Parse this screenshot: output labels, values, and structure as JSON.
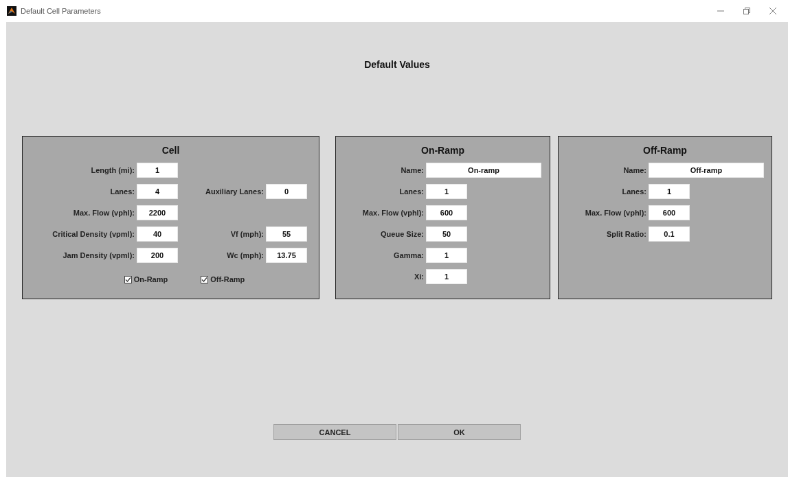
{
  "window": {
    "title": "Default Cell Parameters"
  },
  "heading": "Default Values",
  "cell": {
    "title": "Cell",
    "rows": [
      {
        "left": {
          "label": "Length (mi):",
          "value": "1"
        }
      },
      {
        "left": {
          "label": "Lanes:",
          "value": "4"
        },
        "right": {
          "label": "Auxiliary Lanes:",
          "value": "0"
        }
      },
      {
        "left": {
          "label": "Max. Flow (vphl):",
          "value": "2200"
        }
      },
      {
        "left": {
          "label": "Critical Density (vpml):",
          "value": "40"
        },
        "right": {
          "label": "Vf (mph):",
          "value": "55"
        }
      },
      {
        "left": {
          "label": "Jam Density (vpml):",
          "value": "200"
        },
        "right": {
          "label": "Wc (mph):",
          "value": "13.75"
        }
      }
    ],
    "checkboxes": [
      {
        "label": "On-Ramp",
        "checked": true
      },
      {
        "label": "Off-Ramp",
        "checked": true
      }
    ]
  },
  "on_ramp": {
    "title": "On-Ramp",
    "fields": [
      {
        "label": "Name:",
        "value": "On-ramp",
        "kind": "wide"
      },
      {
        "label": "Lanes:",
        "value": "1",
        "kind": "short"
      },
      {
        "label": "Max. Flow (vphl):",
        "value": "600",
        "kind": "short"
      },
      {
        "label": "Queue Size:",
        "value": "50",
        "kind": "short"
      },
      {
        "label": "Gamma:",
        "value": "1",
        "kind": "short"
      },
      {
        "label": "Xi:",
        "value": "1",
        "kind": "short"
      }
    ]
  },
  "off_ramp": {
    "title": "Off-Ramp",
    "fields": [
      {
        "label": "Name:",
        "value": "Off-ramp",
        "kind": "wide"
      },
      {
        "label": "Lanes:",
        "value": "1",
        "kind": "short"
      },
      {
        "label": "Max. Flow (vphl):",
        "value": "600",
        "kind": "short"
      },
      {
        "label": "Split Ratio:",
        "value": "0.1",
        "kind": "short"
      }
    ]
  },
  "buttons": [
    "CANCEL",
    "OK"
  ]
}
